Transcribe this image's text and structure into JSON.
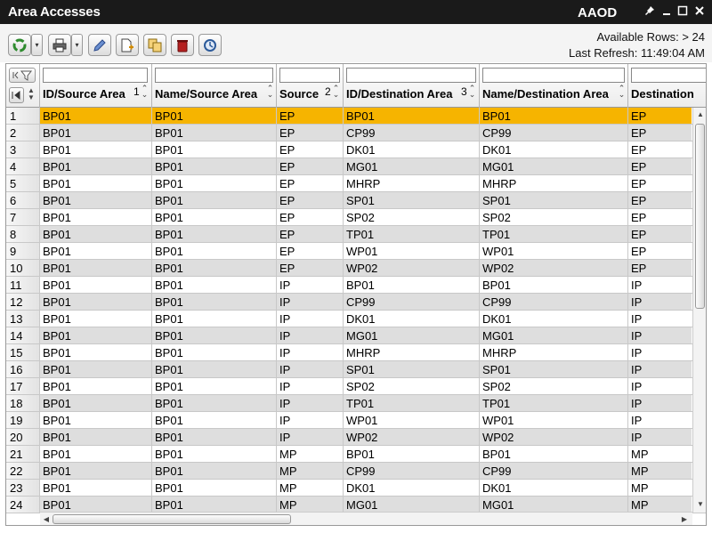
{
  "window": {
    "title": "Area Accesses",
    "code": "AAOD"
  },
  "toolbar": {
    "available_rows": "Available Rows: > 24",
    "last_refresh": "Last Refresh: 11:49:04 AM"
  },
  "columns": [
    {
      "label": "ID/Source Area",
      "sort": "1"
    },
    {
      "label": "Name/Source Area",
      "sort": ""
    },
    {
      "label": "Source",
      "sort": "2"
    },
    {
      "label": "ID/Destination Area",
      "sort": "3"
    },
    {
      "label": "Name/Destination Area",
      "sort": ""
    },
    {
      "label": "Destination",
      "sort": ""
    }
  ],
  "rows": [
    [
      "1",
      "BP01",
      "BP01",
      "EP",
      "BP01",
      "BP01",
      "EP"
    ],
    [
      "2",
      "BP01",
      "BP01",
      "EP",
      "CP99",
      "CP99",
      "EP"
    ],
    [
      "3",
      "BP01",
      "BP01",
      "EP",
      "DK01",
      "DK01",
      "EP"
    ],
    [
      "4",
      "BP01",
      "BP01",
      "EP",
      "MG01",
      "MG01",
      "EP"
    ],
    [
      "5",
      "BP01",
      "BP01",
      "EP",
      "MHRP",
      "MHRP",
      "EP"
    ],
    [
      "6",
      "BP01",
      "BP01",
      "EP",
      "SP01",
      "SP01",
      "EP"
    ],
    [
      "7",
      "BP01",
      "BP01",
      "EP",
      "SP02",
      "SP02",
      "EP"
    ],
    [
      "8",
      "BP01",
      "BP01",
      "EP",
      "TP01",
      "TP01",
      "EP"
    ],
    [
      "9",
      "BP01",
      "BP01",
      "EP",
      "WP01",
      "WP01",
      "EP"
    ],
    [
      "10",
      "BP01",
      "BP01",
      "EP",
      "WP02",
      "WP02",
      "EP"
    ],
    [
      "11",
      "BP01",
      "BP01",
      "IP",
      "BP01",
      "BP01",
      "IP"
    ],
    [
      "12",
      "BP01",
      "BP01",
      "IP",
      "CP99",
      "CP99",
      "IP"
    ],
    [
      "13",
      "BP01",
      "BP01",
      "IP",
      "DK01",
      "DK01",
      "IP"
    ],
    [
      "14",
      "BP01",
      "BP01",
      "IP",
      "MG01",
      "MG01",
      "IP"
    ],
    [
      "15",
      "BP01",
      "BP01",
      "IP",
      "MHRP",
      "MHRP",
      "IP"
    ],
    [
      "16",
      "BP01",
      "BP01",
      "IP",
      "SP01",
      "SP01",
      "IP"
    ],
    [
      "17",
      "BP01",
      "BP01",
      "IP",
      "SP02",
      "SP02",
      "IP"
    ],
    [
      "18",
      "BP01",
      "BP01",
      "IP",
      "TP01",
      "TP01",
      "IP"
    ],
    [
      "19",
      "BP01",
      "BP01",
      "IP",
      "WP01",
      "WP01",
      "IP"
    ],
    [
      "20",
      "BP01",
      "BP01",
      "IP",
      "WP02",
      "WP02",
      "IP"
    ],
    [
      "21",
      "BP01",
      "BP01",
      "MP",
      "BP01",
      "BP01",
      "MP"
    ],
    [
      "22",
      "BP01",
      "BP01",
      "MP",
      "CP99",
      "CP99",
      "MP"
    ],
    [
      "23",
      "BP01",
      "BP01",
      "MP",
      "DK01",
      "DK01",
      "MP"
    ],
    [
      "24",
      "BP01",
      "BP01",
      "MP",
      "MG01",
      "MG01",
      "MP"
    ]
  ],
  "selected_row": 1,
  "colors": {
    "selection": "#f6b400",
    "stripe": "#dedede",
    "titlebar": "#1a1a1a"
  }
}
